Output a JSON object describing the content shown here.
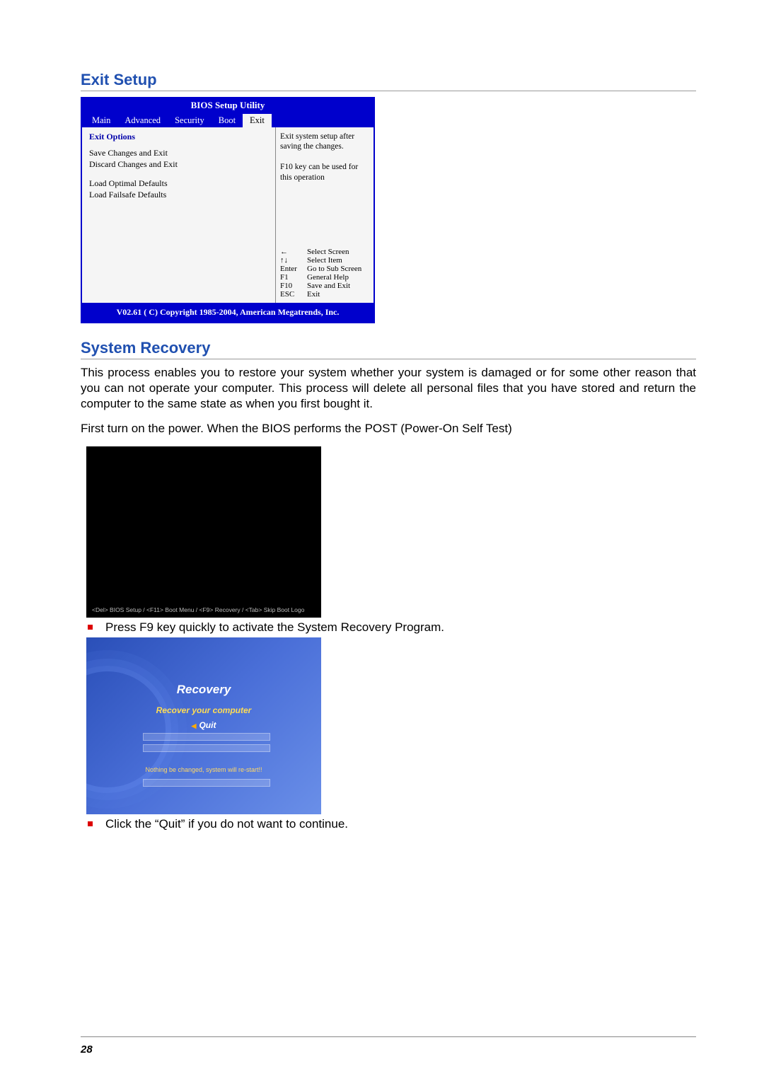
{
  "section1_title": "Exit Setup",
  "bios": {
    "header": "BIOS Setup Utility",
    "tabs": [
      "Main",
      "Advanced",
      "Security",
      "Boot",
      "Exit"
    ],
    "active_tab_index": 4,
    "left_title": "Exit Options",
    "items_group1": [
      "Save Changes and Exit",
      "Discard Changes and Exit"
    ],
    "items_group2": [
      "Load Optimal Defaults",
      "Load Failsafe Defaults"
    ],
    "help": "Exit system setup after saving the changes.\n\nF10 key can be used for this operation",
    "keys": [
      {
        "k": "←",
        "v": "Select Screen"
      },
      {
        "k": "↑↓",
        "v": "Select Item"
      },
      {
        "k": "Enter",
        "v": "Go to Sub Screen"
      },
      {
        "k": "F1",
        "v": "General Help"
      },
      {
        "k": "F10",
        "v": "Save and Exit"
      },
      {
        "k": "ESC",
        "v": "Exit"
      }
    ],
    "footer": "V02.61  ( C) Copyright 1985-2004, American Megatrends, Inc."
  },
  "section2_title": "System Recovery",
  "para1": "This process enables you to restore your system whether your system is damaged or for some other reason that you can not operate your computer.  This process will delete all personal files that you have stored and return the computer to the same state as when you first bought it.",
  "para2": "First turn on the power. When the BIOS performs the POST (Power-On Self Test)",
  "post_text": "<Del> BIOS Setup  /  <F11> Boot Menu  /  <F9> Recovery   /  <Tab> Skip Boot Logo",
  "bullet1": "Press F9 key quickly to activate the System Recovery Program.",
  "recovery": {
    "title": "Recovery",
    "link": "Recover your computer",
    "quit": "Quit",
    "msg": "Nothing be changed, system will re-start!!"
  },
  "bullet2": "Click the “Quit” if you do not want to continue.",
  "page_number": "28"
}
